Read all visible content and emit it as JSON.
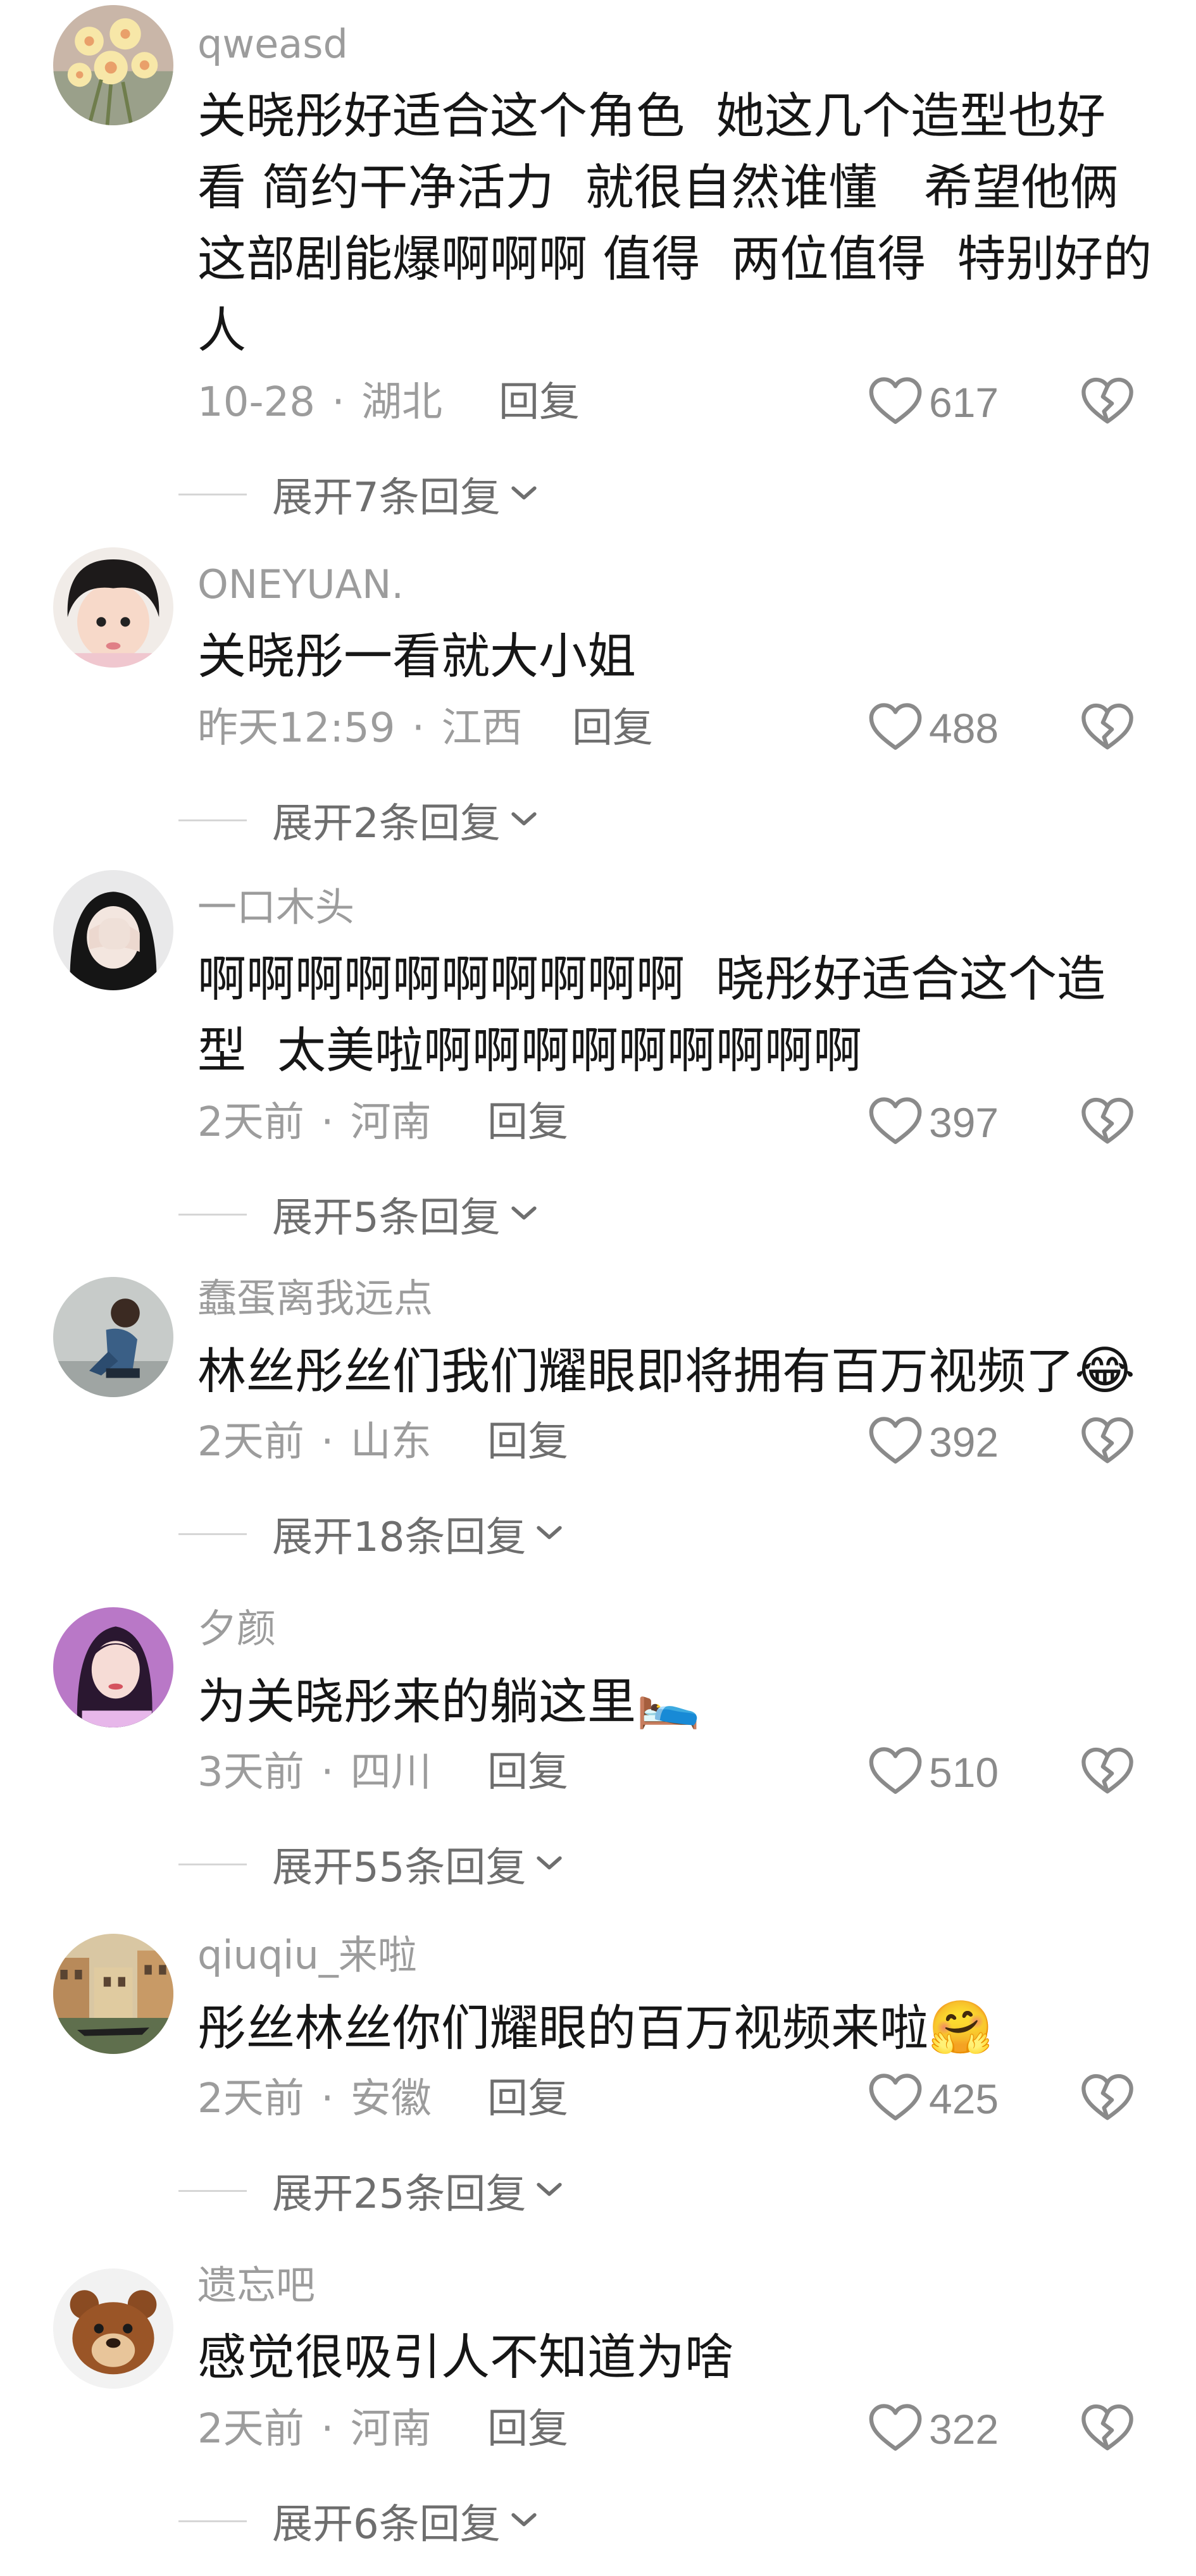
{
  "like_icon": "heart-outline-icon",
  "dislike_icon": "broken-heart-icon",
  "expand_icon": "chevron-down-icon",
  "comments": [
    {
      "username": "qweasd",
      "avatar": "flower-bouquet-avatar",
      "lines": [
        "关晓彤好适合这个角色  她这几个造型也好",
        "看 简约干净活力  就很自然谁懂   希望他俩",
        "这部剧能爆啊啊啊 值得  两位值得  特别好的",
        "人"
      ],
      "emoji": "",
      "time": "10-28",
      "location": "湖北",
      "reply": "回复",
      "likes": "617",
      "expand": "展开7条回复"
    },
    {
      "username": "ONEYUAN.",
      "avatar": "little-girl-avatar",
      "lines": [
        "关晓彤一看就大小姐"
      ],
      "emoji": "",
      "time": "昨天12:59",
      "location": "江西",
      "reply": "回复",
      "likes": "488",
      "expand": "展开2条回复"
    },
    {
      "username": "一口木头",
      "avatar": "girl-covering-face-avatar",
      "lines": [
        "啊啊啊啊啊啊啊啊啊啊  晓彤好适合这个造",
        "型  太美啦啊啊啊啊啊啊啊啊啊"
      ],
      "emoji": "",
      "time": "2天前",
      "location": "河南",
      "reply": "回复",
      "likes": "397",
      "expand": "展开5条回复"
    },
    {
      "username": "蠢蛋离我远点",
      "avatar": "boy-crouching-avatar",
      "lines": [
        "林丝彤丝们我们耀眼即将拥有百万视频了"
      ],
      "emoji": "😂",
      "time": "2天前",
      "location": "山东",
      "reply": "回复",
      "likes": "392",
      "expand": "展开18条回复"
    },
    {
      "username": "夕颜",
      "avatar": "woman-portrait-avatar",
      "lines": [
        "为关晓彤来的躺这里"
      ],
      "emoji": "🛌",
      "time": "3天前",
      "location": "四川",
      "reply": "回复",
      "likes": "510",
      "expand": "展开55条回复"
    },
    {
      "username": "qiuqiu_来啦",
      "avatar": "venice-canal-avatar",
      "lines": [
        "彤丝林丝你们耀眼的百万视频来啦"
      ],
      "emoji": "🤗",
      "time": "2天前",
      "location": "安徽",
      "reply": "回复",
      "likes": "425",
      "expand": "展开25条回复"
    },
    {
      "username": "遗忘吧",
      "avatar": "cartoon-bear-avatar",
      "lines": [
        "感觉很吸引人不知道为啥"
      ],
      "emoji": "",
      "time": "2天前",
      "location": "河南",
      "reply": "回复",
      "likes": "322",
      "expand": "展开6条回复"
    }
  ]
}
